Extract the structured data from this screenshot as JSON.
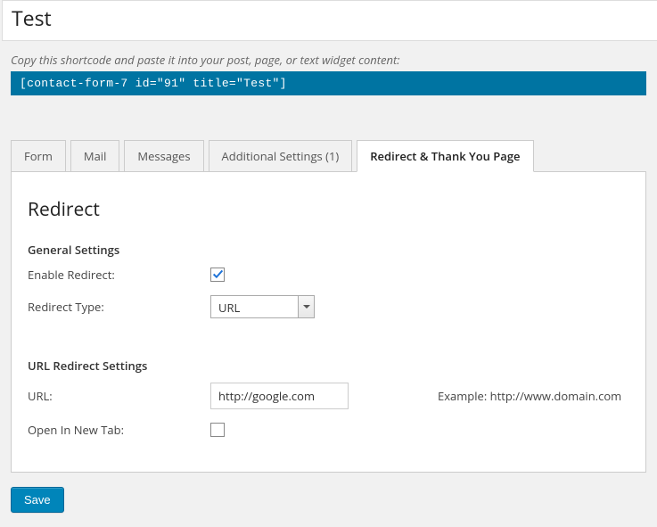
{
  "title": "Test",
  "shortcode": {
    "description": "Copy this shortcode and paste it into your post, page, or text widget content:",
    "code": "[contact-form-7 id=\"91\" title=\"Test\"]"
  },
  "tabs": {
    "form": "Form",
    "mail": "Mail",
    "messages": "Messages",
    "additional": "Additional Settings (1)",
    "redirect": "Redirect & Thank You Page"
  },
  "panel": {
    "heading": "Redirect",
    "general": {
      "title": "General Settings",
      "enable_label": "Enable Redirect:",
      "enable_checked": true,
      "type_label": "Redirect Type:",
      "type_value": "URL"
    },
    "url_settings": {
      "title": "URL Redirect Settings",
      "url_label": "URL:",
      "url_value": "http://google.com",
      "url_example": "Example: http://www.domain.com",
      "newtab_label": "Open In New Tab:",
      "newtab_checked": false
    }
  },
  "save_label": "Save"
}
